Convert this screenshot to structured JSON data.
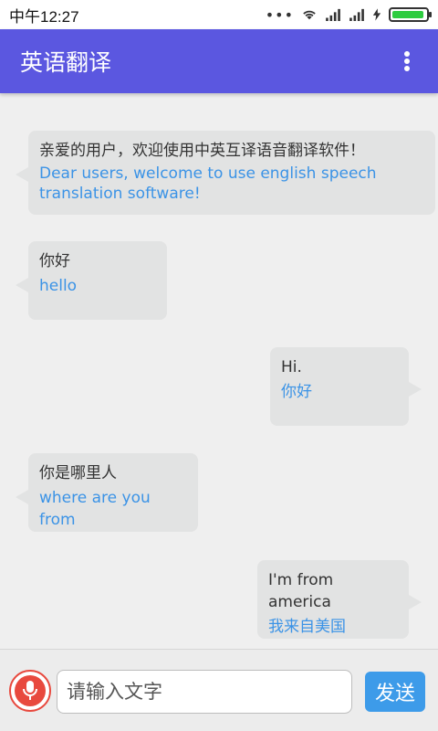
{
  "status_bar": {
    "time": "中午12:27",
    "dots": "•••",
    "battery_level": 0.95
  },
  "app_bar": {
    "title": "英语翻译",
    "menu_icon": "overflow-menu-icon"
  },
  "messages": [
    {
      "side": "left",
      "source": "亲爱的用户，欢迎使用中英互译语音翻译软件！",
      "translation": "Dear users, welcome to use english speech translation software!"
    },
    {
      "side": "left",
      "source": "你好",
      "translation": "hello"
    },
    {
      "side": "right",
      "source": "Hi.",
      "translation": "你好"
    },
    {
      "side": "left",
      "source": "你是哪里人",
      "translation": "where are you from"
    },
    {
      "side": "right",
      "source": "I'm from america",
      "translation": "我来自美国"
    }
  ],
  "input_bar": {
    "mic_icon": "microphone-icon",
    "placeholder": "请输入文字",
    "send_label": "发送"
  },
  "colors": {
    "app_bar": "#5b57e0",
    "bubble": "#e2e3e3",
    "translation_text": "#3b93e6",
    "mic": "#e8493e",
    "send_button": "#3d9be9"
  }
}
